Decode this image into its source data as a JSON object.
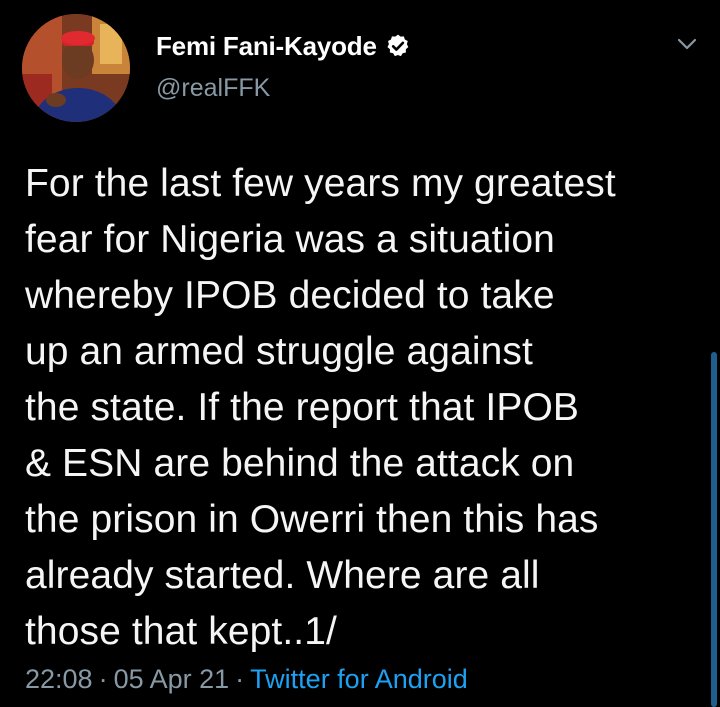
{
  "author": {
    "display_name": "Femi Fani-Kayode",
    "handle": "@realFFK",
    "verified": true,
    "avatar_icon": "profile-photo"
  },
  "tweet": {
    "lines": [
      "For the last few years my greatest",
      "fear for Nigeria was a situation",
      "whereby IPOB decided to take",
      "up an armed struggle against",
      "the state. If the report that IPOB",
      "& ESN are behind the attack on",
      "the prison in Owerri then this has",
      "already started. Where are all",
      "those that kept..1/"
    ]
  },
  "meta": {
    "time": "22:08",
    "separator": "·",
    "date": "05 Apr 21",
    "source": "Twitter for Android"
  },
  "colors": {
    "background": "#000000",
    "text": "#f5f5f5",
    "secondary": "#8899a6",
    "link": "#1da1f2"
  }
}
